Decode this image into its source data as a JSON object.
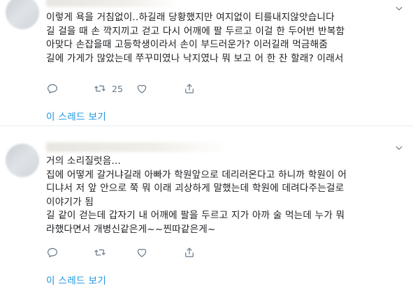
{
  "tweets": [
    {
      "lines": [
        "이렇게 욕을 거침없이..하길래 당황했지만 여지없이 티를내지않앗습니다",
        "길 걸을 때 손 깍지끼고 걷고 다시 어깨에 팔 두르고 이걸 한 두어번 반복함",
        "아맞다 손잡을때 고등학생이라서 손이 부드러운가? 이러길래 먹금해줌",
        "길에 가게가 많았는데 쭈꾸미였나 낙지였나 뭐 보고 어 한 잔 할래? 이래서"
      ],
      "reply_count": "",
      "retweet_count": "25",
      "like_count": "",
      "thread_link": "이 스레드 보기"
    },
    {
      "lines": [
        "거의 소리질럿음...",
        "집에 어떻게 갈거냐길래 아빠가 학원앞으로 데리러온다고 하니까 학원이 어",
        "디냐서 저 앞 안으로 쭉 뭐 이래 괴상하게 말했는데 학원에 데려다주는걸로",
        "이야기가 됨",
        "길 같이 걷는데 갑자기 내 어깨에 팔을 두르고 지가 아까 술 먹는데 누가 뭐",
        "라했다면서 개병신같은게~~찐따같은게~"
      ],
      "reply_count": "",
      "retweet_count": "",
      "like_count": "",
      "thread_link": "이 스레드 보기"
    }
  ],
  "icons": {
    "more": "chevron-down-icon",
    "reply": "reply-icon",
    "retweet": "retweet-icon",
    "like": "heart-icon",
    "share": "share-icon"
  },
  "colors": {
    "text": "#1c1e21",
    "muted": "#657786",
    "link": "#1b95e0",
    "divider": "#e6ecf0"
  }
}
